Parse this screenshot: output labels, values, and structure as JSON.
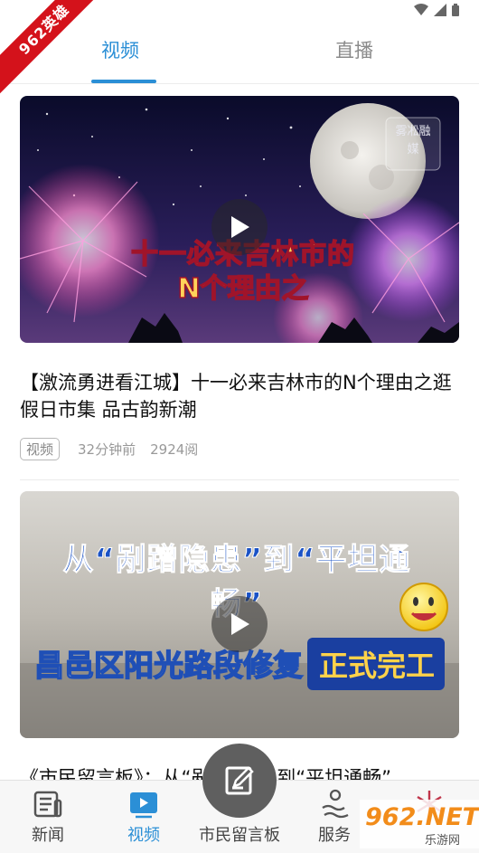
{
  "ribbon": {
    "text": "962英雄"
  },
  "tabs": [
    {
      "label": "视频"
    },
    {
      "label": "直播"
    }
  ],
  "cards": [
    {
      "overlay_line1": "十一必来吉林市的",
      "overlay_line2": "N个理由之",
      "logo": "雾凇融媒",
      "title": "【激流勇进看江城】十一必来吉林市的N个理由之逛假日市集  品古韵新潮",
      "tag": "视频",
      "time": "32分钟前",
      "reads": "2924阅"
    },
    {
      "overlay_line1": "从“剐蹭隐患”到“平坦通畅”",
      "overlay_line2": "昌邑区阳光路段修复",
      "overlay_line3": "正式完工",
      "title": "《市民留言板》：从“剐蹭隐患”到“平坦通畅”"
    }
  ],
  "bottom_nav": [
    {
      "label": "新闻",
      "icon": "news-icon"
    },
    {
      "label": "视频",
      "icon": "video-icon"
    },
    {
      "label": "市民留言板",
      "icon": "message-board-icon"
    },
    {
      "label": "服务",
      "icon": "service-icon"
    },
    {
      "label": "",
      "icon": "snowflake-icon"
    }
  ],
  "watermark": {
    "text": "962.NET",
    "subtext": "乐游网"
  },
  "colors": {
    "accent": "#2b8fd6",
    "ribbon": "#d4121b"
  }
}
